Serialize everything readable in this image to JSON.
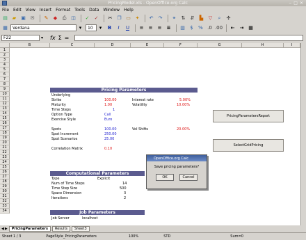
{
  "window": {
    "title": "PricingModel.xls - OpenOffice.org Calc"
  },
  "menus": [
    "File",
    "Edit",
    "View",
    "Insert",
    "Format",
    "Tools",
    "Data",
    "Window",
    "Help"
  ],
  "font": {
    "name": "Verdana",
    "size": "10"
  },
  "namebox": "F22",
  "fx_symbol": "fx",
  "sum_symbol": "Σ",
  "eq_symbol": "=",
  "columns": [
    "B",
    "C",
    "D",
    "E",
    "F",
    "G",
    "H",
    "I"
  ],
  "rows": [
    "1",
    "2",
    "3",
    "4",
    "5",
    "6",
    "7",
    "8",
    "9",
    "10",
    "11",
    "12",
    "13",
    "14",
    "15",
    "16",
    "17",
    "18",
    "19",
    "20",
    "21",
    "22",
    "23",
    "24",
    "25",
    "26",
    "27",
    "28",
    "29",
    "30",
    "31",
    "32",
    "33",
    "34"
  ],
  "sections": {
    "pricing": "Pricing Parameters",
    "computational": "Computational Parameters",
    "job": "Job Parameters"
  },
  "pricing_rows": [
    {
      "label": "Underlying",
      "value": "",
      "label2": "",
      "value2": ""
    },
    {
      "label": "Strike",
      "value": "100.00",
      "label2": "Interest rate",
      "value2": "5.00%"
    },
    {
      "label": "Maturity",
      "value": "1.00",
      "label2": "Volatility",
      "value2": "10.00%"
    },
    {
      "label": "Time Steps",
      "value": "1",
      "label2": "",
      "value2": ""
    },
    {
      "label": "Option Type",
      "value": "Call",
      "label2": "",
      "value2": ""
    },
    {
      "label": "Exercise Style",
      "value": "Euro",
      "label2": "",
      "value2": ""
    }
  ],
  "spot_rows": [
    {
      "label": "Spots",
      "value": "100.00",
      "label2": "Vol Shifts",
      "value2": "20.00%"
    },
    {
      "label": "Spot Increment",
      "value": "250.00",
      "label2": "",
      "value2": ""
    },
    {
      "label": "Spot Scenarios",
      "value": "25.00",
      "label2": "",
      "value2": ""
    }
  ],
  "correlation": {
    "label": "Correlation Matrix",
    "value": "0.10"
  },
  "comp_rows": [
    {
      "label": "Type",
      "value": "Explicit"
    },
    {
      "label": "Num of Time Steps",
      "value": "14"
    },
    {
      "label": "Time Step Size",
      "value": "500"
    },
    {
      "label": "Space Dimension",
      "value": "3"
    },
    {
      "label": "Iterations",
      "value": "2"
    }
  ],
  "job_rows": [
    {
      "label": "Job Server",
      "value": "localhost"
    }
  ],
  "buttons": {
    "pricing_report": "PricingParametersReport",
    "grid_pricing": "SelectGridPricing"
  },
  "dialog": {
    "title": "OpenOffice.org Calc",
    "message": "Save pricing parameters?",
    "ok": "OK",
    "cancel": "Cancel"
  },
  "tabs": [
    "PricingParameters",
    "Results",
    "Sheet3"
  ],
  "status": {
    "sheet": "Sheet 1 / 3",
    "style": "PageStyle_PricingParameters",
    "zoom": "100%",
    "mode": "STD",
    "sum": "Sum=0"
  }
}
